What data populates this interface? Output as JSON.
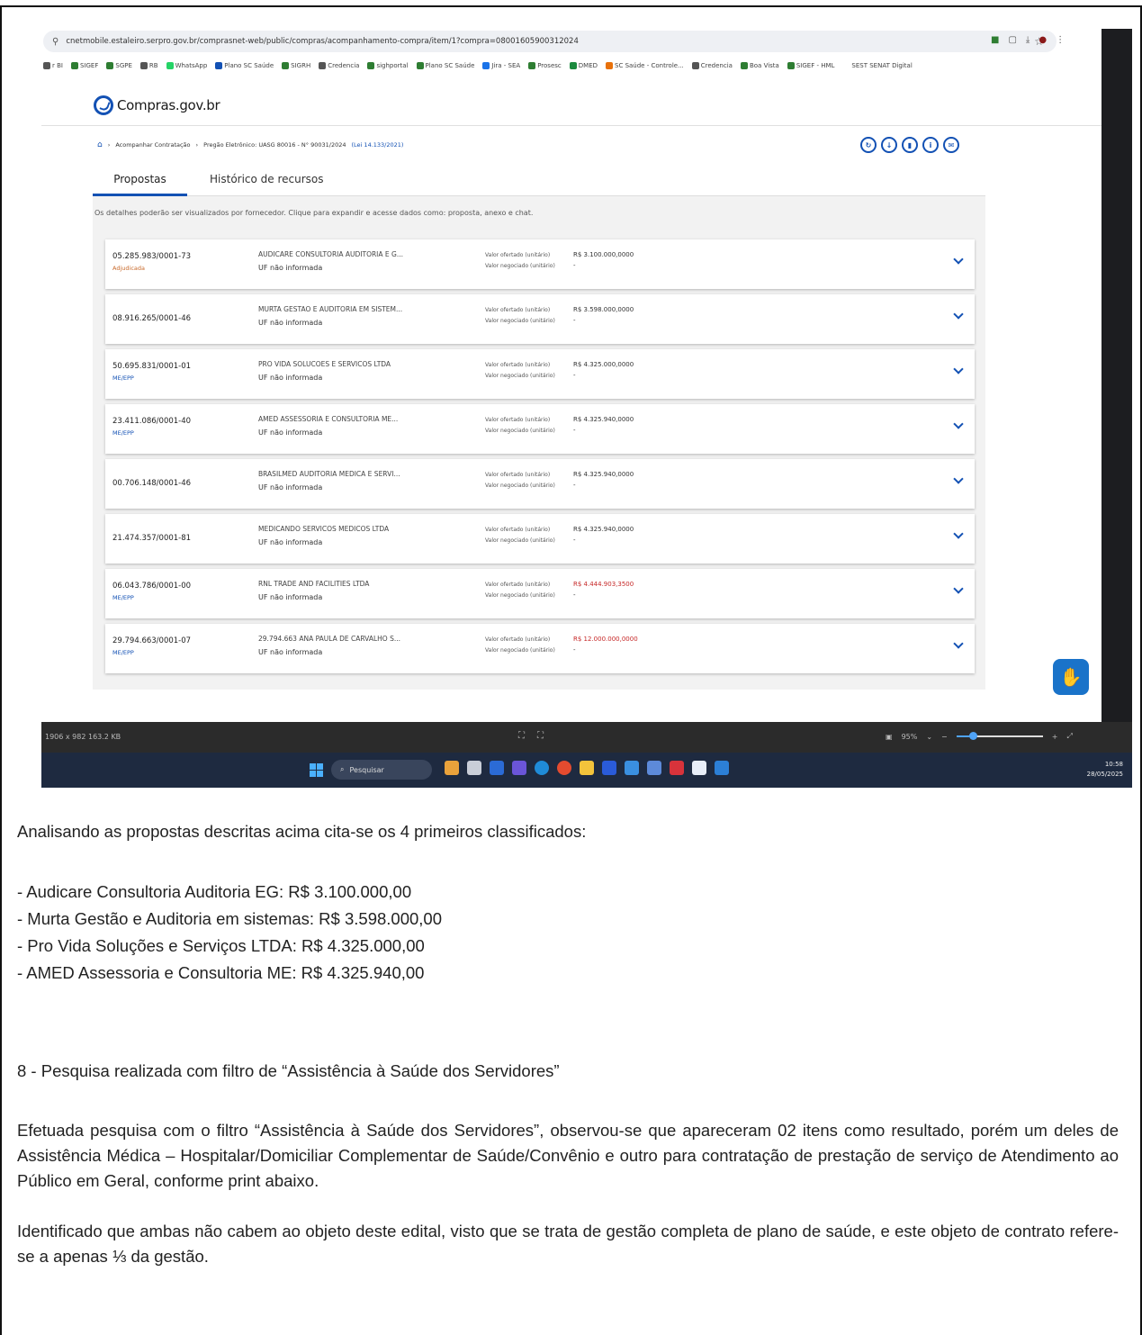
{
  "screenshot": {
    "browser": {
      "url": "cnetmobile.estaleiro.serpro.gov.br/comprasnet-web/public/compras/acompanhamento-compra/item/1?compra=08001605900312024",
      "bookmarks": [
        "r BI",
        "SIGEF",
        "SGPE",
        "RB",
        "WhatsApp",
        "Plano SC Saúde",
        "SIGRH",
        "Credencia",
        "sighportal",
        "Plano SC Saúde",
        "Jira - SEA",
        "Prosesc",
        "DMED",
        "SC Saúde - Controle...",
        "Credencia",
        "Boa Vista",
        "SIGEF - HML",
        "SEST SENAT Digital"
      ]
    },
    "site": {
      "logo": "Compras.gov.br",
      "breadcrumb": {
        "step1": "Acompanhar Contratação",
        "step2": "Pregão Eletrônico: UASG 80016 - N° 90031/2024",
        "law": "(Lei 14.133/2021)"
      },
      "tabs": [
        "Propostas",
        "Histórico de recursos"
      ],
      "hint": "Os detalhes poderão ser visualizados por fornecedor. Clique para expandir e acesse dados como: proposta, anexo e chat.",
      "label_offered": "Valor ofertado (unitário)",
      "label_negotiated": "Valor negociado (unitário)",
      "proposals": [
        {
          "cnpj": "05.285.983/0001-73",
          "tag": "Adjudicada",
          "name": "AUDICARE CONSULTORIA AUDITORIA E G...",
          "uf": "UF não informada",
          "offered": "R$ 3.100.000,0000",
          "negotiated": "-"
        },
        {
          "cnpj": "08.916.265/0001-46",
          "tag": "",
          "name": "MURTA GESTAO E AUDITORIA EM SISTEM...",
          "uf": "UF não informada",
          "offered": "R$ 3.598.000,0000",
          "negotiated": "-"
        },
        {
          "cnpj": "50.695.831/0001-01",
          "tag": "ME/EPP",
          "name": "PRO VIDA SOLUCOES E SERVICOS LTDA",
          "uf": "UF não informada",
          "offered": "R$ 4.325.000,0000",
          "negotiated": "-"
        },
        {
          "cnpj": "23.411.086/0001-40",
          "tag": "ME/EPP",
          "name": "AMED ASSESSORIA E CONSULTORIA ME...",
          "uf": "UF não informada",
          "offered": "R$ 4.325.940,0000",
          "negotiated": "-"
        },
        {
          "cnpj": "00.706.148/0001-46",
          "tag": "",
          "name": "BRASILMED AUDITORIA MEDICA E SERVI...",
          "uf": "UF não informada",
          "offered": "R$ 4.325.940,0000",
          "negotiated": "-"
        },
        {
          "cnpj": "21.474.357/0001-81",
          "tag": "",
          "name": "MEDICANDO SERVICOS MEDICOS LTDA",
          "uf": "UF não informada",
          "offered": "R$ 4.325.940,0000",
          "negotiated": "-"
        },
        {
          "cnpj": "06.043.786/0001-00",
          "tag": "ME/EPP",
          "name": "RNL TRADE AND FACILITIES LTDA",
          "uf": "UF não informada",
          "offered": "R$ 4.444.903,3500",
          "negotiated": "-"
        },
        {
          "cnpj": "29.794.663/0001-07",
          "tag": "ME/EPP",
          "name": "29.794.663 ANA PAULA DE CARVALHO S...",
          "uf": "UF não informada",
          "offered": "R$ 12.000.000,0000",
          "negotiated": "-"
        }
      ]
    },
    "viewer": {
      "info": "1906 x 982   163.2 KB",
      "zoom": "95%"
    },
    "taskbar": {
      "search": "Pesquisar",
      "time": "10:58",
      "date": "28/05/2025"
    }
  },
  "document": {
    "intro": "Analisando as propostas descritas acima cita-se os 4 primeiros classificados:",
    "ranking": [
      "- Audicare Consultoria Auditoria EG: R$ 3.100.000,00",
      "- Murta Gestão e Auditoria em sistemas: R$ 3.598.000,00",
      "- Pro Vida Soluções e Serviços LTDA: R$ 4.325.000,00",
      "- AMED Assessoria e Consultoria ME: R$ 4.325.940,00"
    ],
    "section_title": "8 - Pesquisa realizada com filtro de “Assistência à Saúde dos Servidores”",
    "paragraph1": "Efetuada pesquisa com o filtro “Assistência à Saúde dos Servidores”, observou-se que apareceram 02 itens como resultado, porém um deles de Assistência Médica – Hospitalar/Domiciliar Complementar de Saúde/Convênio e outro para contratação de prestação de serviço de Atendimento ao Público em Geral, conforme print abaixo.",
    "paragraph2": "Identificado que ambas não cabem ao objeto deste edital, visto que se trata de gestão completa de plano de saúde, e este objeto de contrato refere-se a apenas ⅓ da gestão."
  }
}
